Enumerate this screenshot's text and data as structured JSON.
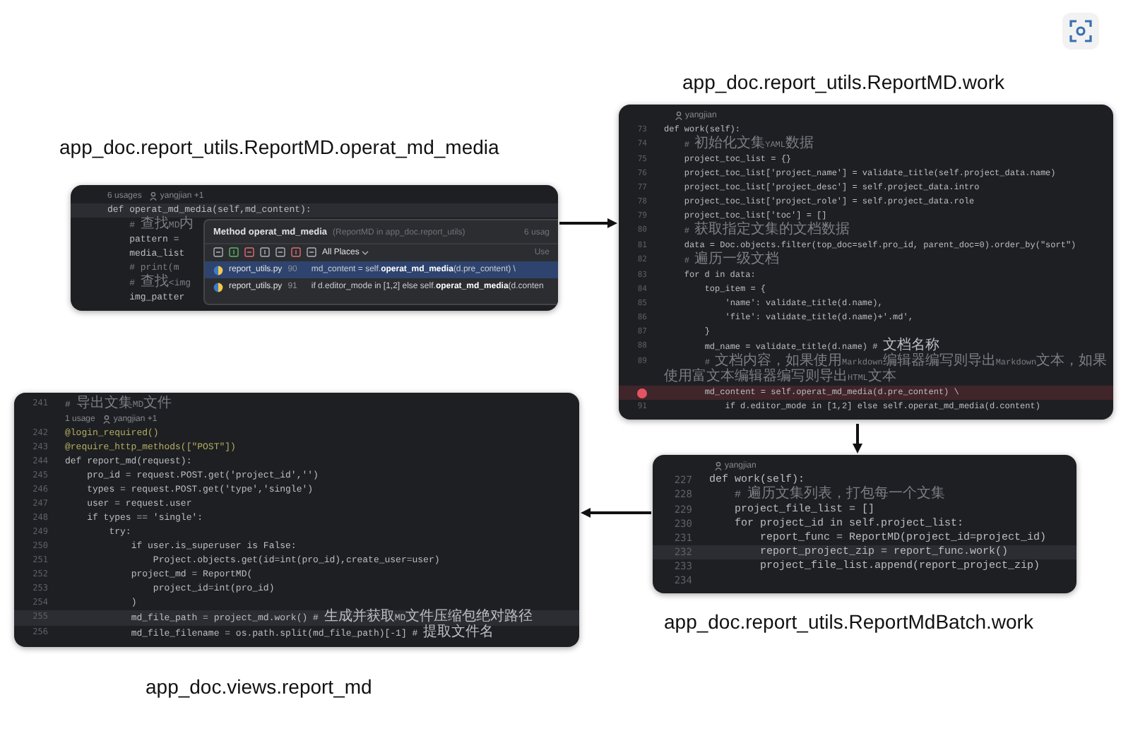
{
  "media_method": {
    "title": "app_doc.report_utils.ReportMD.operat_md_media",
    "usage": {
      "count": "6 usages",
      "author": "yangjian +1"
    },
    "signature": {
      "text": "def operat_md_media(self,md_content):",
      "kind": "current"
    },
    "code_lines": [
      {
        "text": "    # 查找MD内",
        "kind": "comment"
      },
      {
        "text": "    pattern =",
        "kind": "code"
      },
      {
        "text": "    media_list",
        "kind": "code"
      },
      {
        "text": "    # print(m",
        "kind": "comment"
      },
      {
        "text": "    # 查找<img",
        "kind": "comment"
      },
      {
        "text": "    img_patter",
        "kind": "code"
      }
    ],
    "popup": {
      "title": "Method operat_md_media",
      "context": "(ReportMD in app_doc.report_utils)",
      "count": "6 usag",
      "scope": "All Places",
      "column_cut": "Use",
      "rows": [
        {
          "file": "report_utils.py",
          "line": "90",
          "code": "md_content = self.**operat_md_media**(d.pre_content) \\",
          "selected": true
        },
        {
          "file": "report_utils.py",
          "line": "91",
          "code": "if d.editor_mode in [1,2] else self.**operat_md_media**(d.conten",
          "selected": false
        }
      ]
    }
  },
  "report_md_work": {
    "title": "app_doc.report_utils.ReportMD.work",
    "usage": {
      "author": "yangjian"
    },
    "lines": [
      {
        "num": "73",
        "text": "def work(self):",
        "kind": "code"
      },
      {
        "num": "74",
        "text": "    # 初始化文集YAML数据",
        "kind": "comment"
      },
      {
        "num": "75",
        "text": "    project_toc_list = {}",
        "kind": "code"
      },
      {
        "num": "76",
        "text": "    project_toc_list['project_name'] = validate_title(self.project_data.name)",
        "kind": "code"
      },
      {
        "num": "77",
        "text": "    project_toc_list['project_desc'] = self.project_data.intro",
        "kind": "code"
      },
      {
        "num": "78",
        "text": "    project_toc_list['project_role'] = self.project_data.role",
        "kind": "code"
      },
      {
        "num": "79",
        "text": "    project_toc_list['toc'] = []",
        "kind": "code"
      },
      {
        "num": "80",
        "text": "    # 获取指定文集的文档数据",
        "kind": "comment"
      },
      {
        "num": "81",
        "text": "    data = Doc.objects.filter(top_doc=self.pro_id, parent_doc=0).order_by(\"sort\")",
        "kind": "code"
      },
      {
        "num": "82",
        "text": "    # 遍历一级文档",
        "kind": "comment"
      },
      {
        "num": "83",
        "text": "    for d in data:",
        "kind": "code"
      },
      {
        "num": "84",
        "text": "        top_item = {",
        "kind": "code"
      },
      {
        "num": "85",
        "text": "            'name': validate_title(d.name),",
        "kind": "code"
      },
      {
        "num": "86",
        "text": "            'file': validate_title(d.name)+'.md',",
        "kind": "code"
      },
      {
        "num": "87",
        "text": "        }",
        "kind": "code"
      },
      {
        "num": "88",
        "text": "        md_name = validate_title(d.name) # 文档名称",
        "kind": "code"
      },
      {
        "num": "89",
        "text": "        # 文档内容，如果使用Markdown编辑器编写则导出Markdown文本，如果使用富文本编辑器编写则导出HTML文本",
        "kind": "comment"
      },
      {
        "text": "        md_content = self.operat_md_media(d.pre_content) \\",
        "kind": "breakpoint"
      },
      {
        "num": "91",
        "text": "            if d.editor_mode in [1,2] else self.operat_md_media(d.content)",
        "kind": "code"
      }
    ]
  },
  "batch_work": {
    "title": "app_doc.report_utils.ReportMdBatch.work",
    "usage": {
      "author": "yangjian"
    },
    "lines": [
      {
        "num": "227",
        "text": "def work(self):",
        "kind": "code"
      },
      {
        "num": "228",
        "text": "    # 遍历文集列表，打包每一个文集",
        "kind": "comment"
      },
      {
        "num": "229",
        "text": "    project_file_list = []",
        "kind": "code"
      },
      {
        "num": "230",
        "text": "    for project_id in self.project_list:",
        "kind": "code"
      },
      {
        "num": "231",
        "text": "        report_func = ReportMD(project_id=project_id)",
        "kind": "code"
      },
      {
        "num": "232",
        "text": "        report_project_zip = report_func.work()",
        "kind": "current"
      },
      {
        "num": "233",
        "text": "        project_file_list.append(report_project_zip)",
        "kind": "code"
      },
      {
        "num": "234"
      }
    ]
  },
  "view_report_md": {
    "title": "app_doc.views.report_md",
    "lines": [
      {
        "num": "241",
        "text": "# 导出文集MD文件",
        "kind": "comment"
      },
      {
        "usage": {
          "count": "1 usage",
          "author": "yangjian +1"
        }
      },
      {
        "num": "242",
        "text": "@login_required()",
        "kind": "decorator"
      },
      {
        "num": "243",
        "text": "@require_http_methods([\"POST\"])",
        "kind": "decorator"
      },
      {
        "num": "244",
        "text": "def report_md(request):",
        "kind": "code"
      },
      {
        "num": "245",
        "text": "    pro_id = request.POST.get('project_id','')",
        "kind": "code"
      },
      {
        "num": "246",
        "text": "    types = request.POST.get('type','single')",
        "kind": "code"
      },
      {
        "num": "247",
        "text": "    user = request.user",
        "kind": "code"
      },
      {
        "num": "248",
        "text": "    if types == 'single':",
        "kind": "code"
      },
      {
        "num": "249",
        "text": "        try:",
        "kind": "code"
      },
      {
        "num": "250",
        "text": "            if user.is_superuser is False:",
        "kind": "code"
      },
      {
        "num": "251",
        "text": "                Project.objects.get(id=int(pro_id),create_user=user)",
        "kind": "code"
      },
      {
        "num": "252",
        "text": "            project_md = ReportMD(",
        "kind": "code"
      },
      {
        "num": "253",
        "text": "                project_id=int(pro_id)",
        "kind": "code"
      },
      {
        "num": "254",
        "text": "            )",
        "kind": "code"
      },
      {
        "num": "255",
        "text": "            md_file_path = project_md.work() # 生成并获取MD文件压缩包绝对路径",
        "kind": "current"
      },
      {
        "num": "256",
        "text": "            md_file_filename = os.path.split(md_file_path)[-1] # 提取文件名",
        "kind": "code"
      }
    ]
  }
}
